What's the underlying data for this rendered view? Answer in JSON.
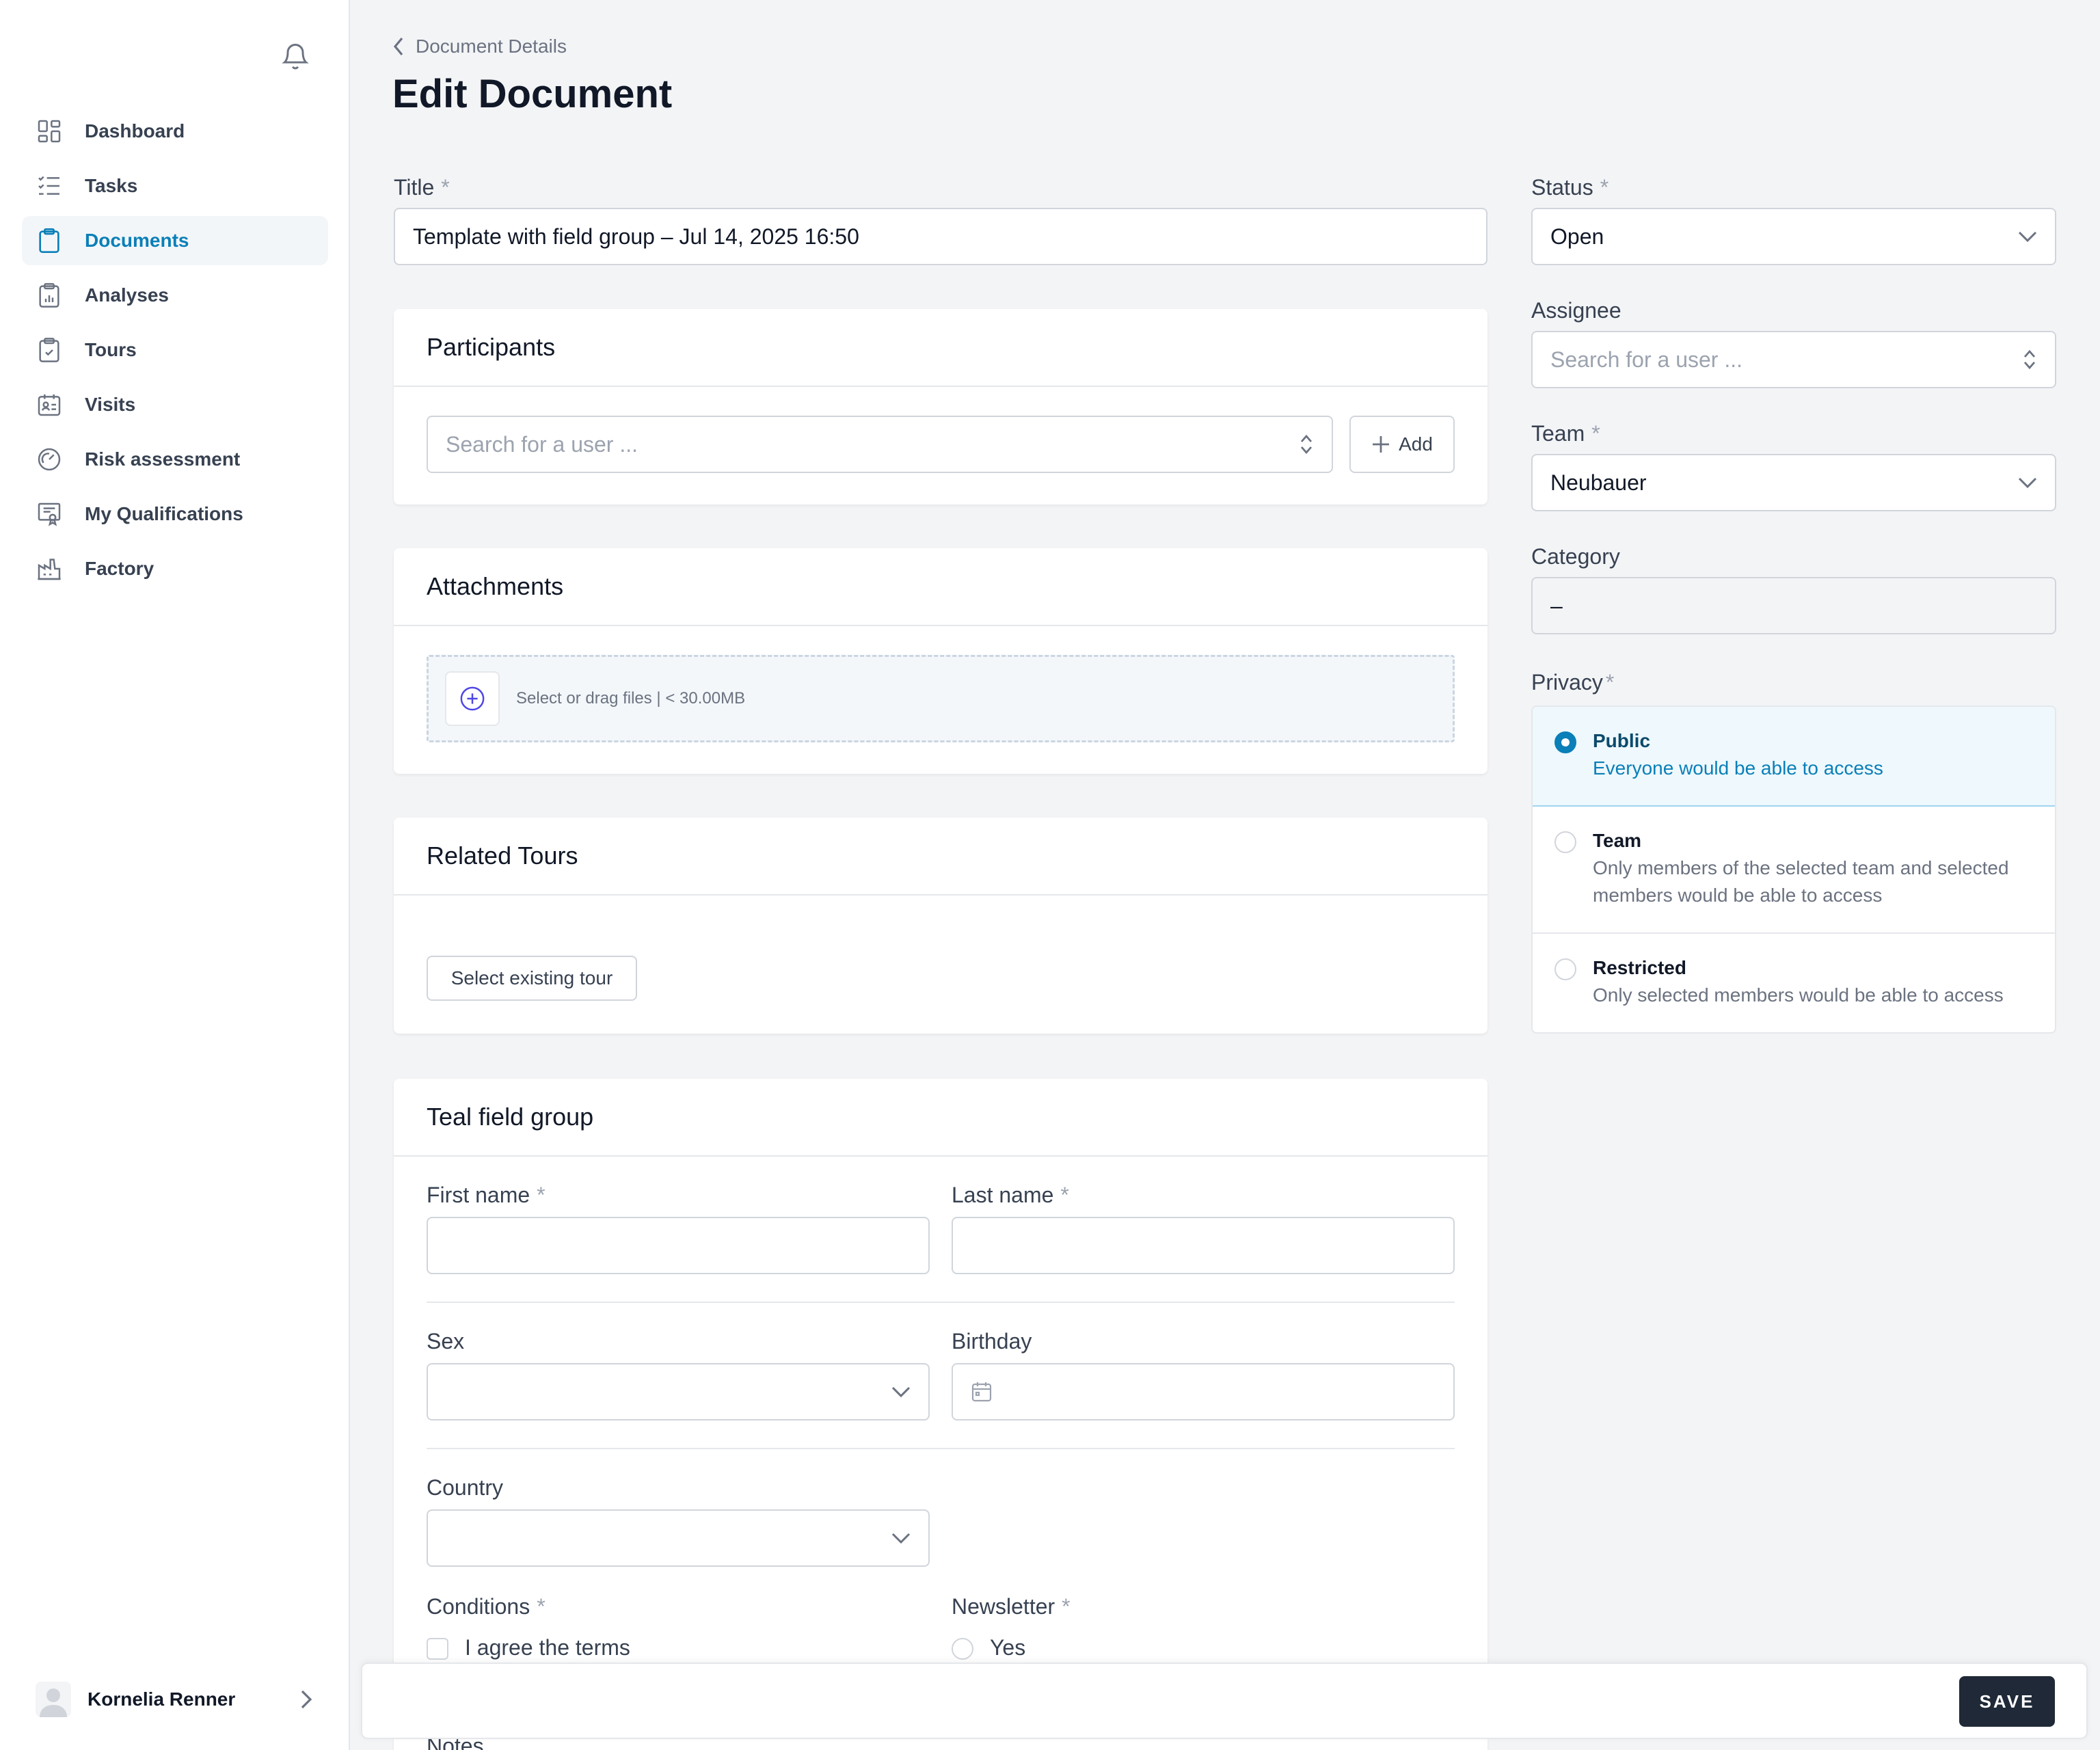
{
  "sidebar": {
    "items": [
      {
        "label": "Dashboard",
        "icon": "dashboard-icon"
      },
      {
        "label": "Tasks",
        "icon": "tasks-icon"
      },
      {
        "label": "Documents",
        "icon": "clipboard-icon",
        "active": true
      },
      {
        "label": "Analyses",
        "icon": "clipboard-chart-icon"
      },
      {
        "label": "Tours",
        "icon": "clipboard-check-icon"
      },
      {
        "label": "Visits",
        "icon": "calendar-user-icon"
      },
      {
        "label": "Risk assessment",
        "icon": "gauge-icon"
      },
      {
        "label": "My Qualifications",
        "icon": "certificate-icon"
      },
      {
        "label": "Factory",
        "icon": "factory-icon"
      }
    ],
    "user_name": "Kornelia Renner"
  },
  "header": {
    "breadcrumb": "Document Details",
    "title": "Edit Document"
  },
  "form": {
    "title_label": "Title",
    "title_value": "Template with field group – Jul 14, 2025 16:50",
    "required_mark": "*",
    "participants": {
      "heading": "Participants",
      "search_placeholder": "Search for a user ...",
      "add_label": "Add"
    },
    "attachments": {
      "heading": "Attachments",
      "dropzone_text": "Select or drag files | < 30.00MB"
    },
    "related_tours": {
      "heading": "Related Tours",
      "button_label": "Select existing tour"
    },
    "field_group": {
      "heading": "Teal field group",
      "first_name_label": "First name",
      "last_name_label": "Last name",
      "sex_label": "Sex",
      "birthday_label": "Birthday",
      "country_label": "Country",
      "conditions_label": "Conditions",
      "conditions_option": "I agree the terms",
      "newsletter_label": "Newsletter",
      "newsletter_option": "Yes",
      "notes_label": "Notes"
    }
  },
  "side": {
    "status_label": "Status",
    "status_value": "Open",
    "assignee_label": "Assignee",
    "assignee_placeholder": "Search for a user ...",
    "team_label": "Team",
    "team_value": "Neubauer",
    "category_label": "Category",
    "category_value": "–",
    "privacy_label": "Privacy",
    "privacy_options": [
      {
        "title": "Public",
        "desc": "Everyone would be able to access",
        "selected": true
      },
      {
        "title": "Team",
        "desc": "Only members of the selected team and selected members would be able to access",
        "selected": false
      },
      {
        "title": "Restricted",
        "desc": "Only selected members would be able to access",
        "selected": false
      }
    ]
  },
  "footer": {
    "save_label": "SAVE"
  },
  "colors": {
    "accent": "#0a7fb8",
    "save_button": "#1f2937",
    "background": "#f3f4f6"
  }
}
